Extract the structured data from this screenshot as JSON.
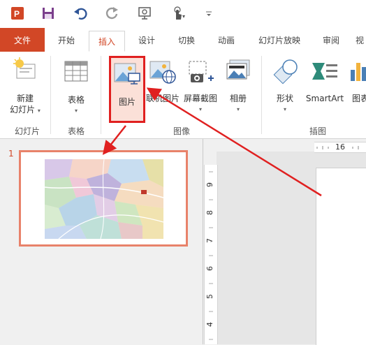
{
  "app": {
    "logo": "P",
    "accent": "#d24726"
  },
  "qat": {
    "icons": [
      "powerpoint-logo-icon",
      "save-icon",
      "undo-icon",
      "redo-icon",
      "present-icon",
      "touch-mode-icon",
      "customize-qat-icon"
    ]
  },
  "tabs": [
    "文件",
    "开始",
    "插入",
    "设计",
    "切换",
    "动画",
    "幻灯片放映",
    "审阅",
    "视"
  ],
  "active_tab": "插入",
  "ribbon": {
    "new_slide": "新建\n幻灯片",
    "new_slide_line1": "新建",
    "new_slide_line2": "幻灯片",
    "table": "表格",
    "pictures": "图片",
    "online_pictures": "联机图片",
    "screenshot": "屏幕截图",
    "album": "相册",
    "shapes": "形状",
    "smartart": "SmartArt",
    "chart": "图表",
    "group_slides": "幻灯片",
    "group_tables": "表格",
    "group_images": "图像",
    "group_illustrations": "插图"
  },
  "thumbnail": {
    "number": "1"
  },
  "ruler": {
    "h_label": "16",
    "v_labels": [
      "9",
      "8",
      "7",
      "6",
      "5",
      "4"
    ]
  },
  "colors": {
    "highlight_red": "#e02020",
    "thumb_border": "#e8826a"
  }
}
